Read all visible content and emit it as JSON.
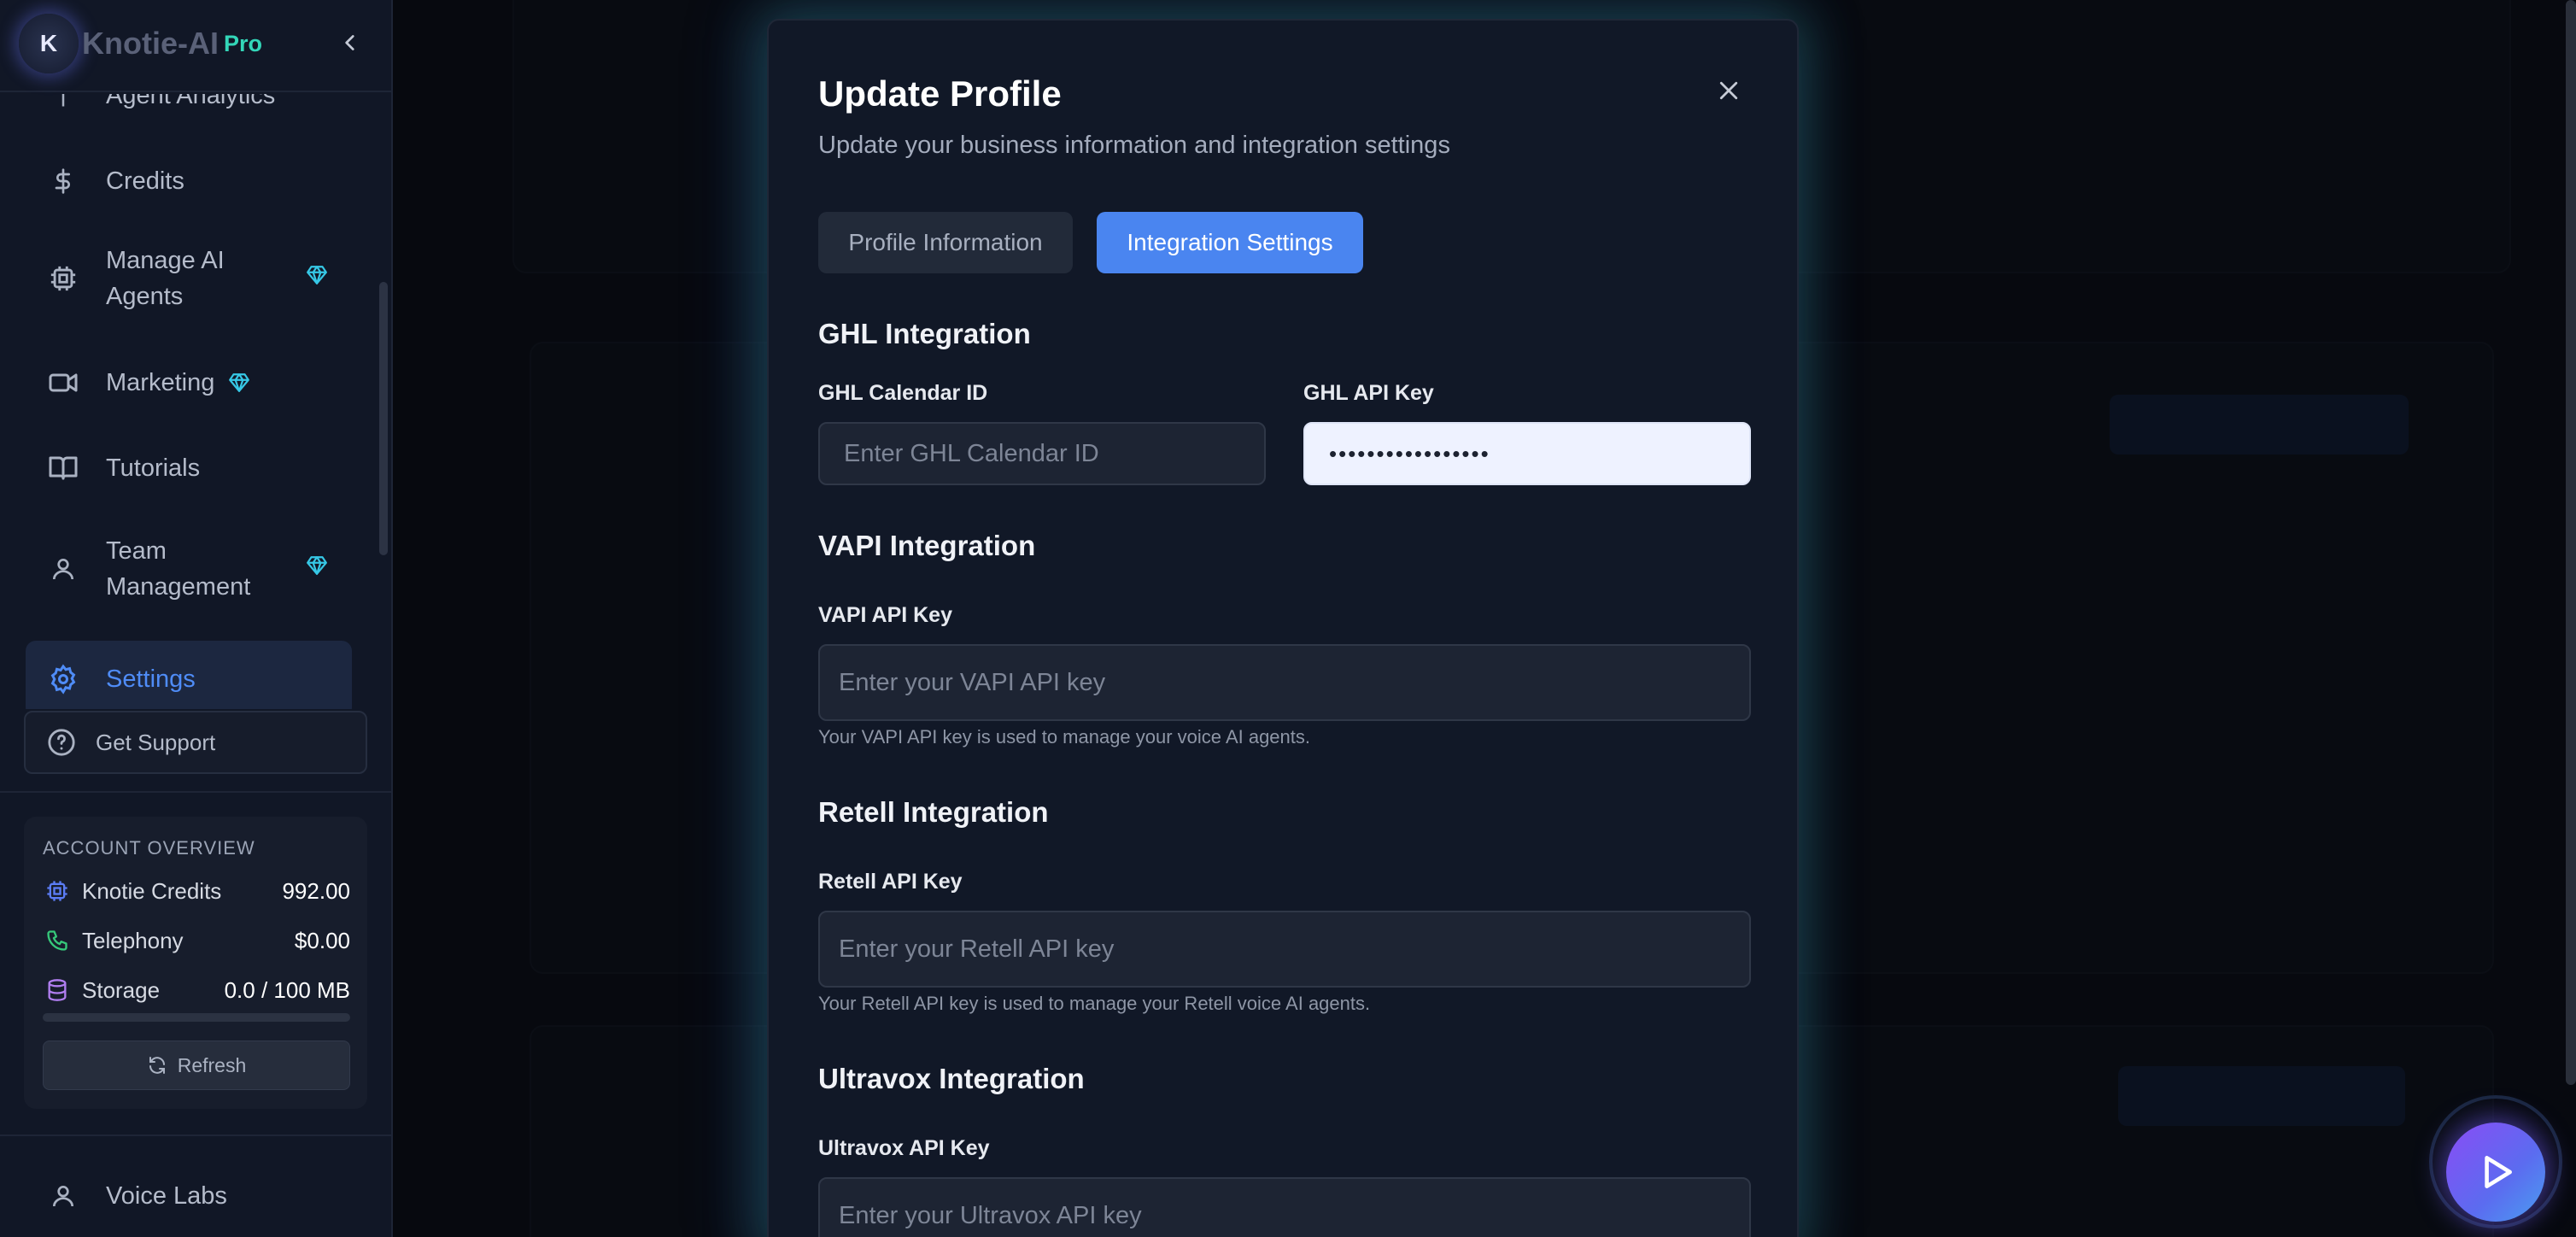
{
  "sidebar": {
    "logo_letter": "K",
    "brand": "Knotie-AI",
    "pro_badge": "Pro",
    "partial_item": "Agent Analytics",
    "items": [
      {
        "label": "Credits",
        "icon": "dollar-icon"
      },
      {
        "label": "Manage AI Agents",
        "icon": "cpu-chip-icon",
        "premium": true
      },
      {
        "label": "Marketing",
        "icon": "video-icon",
        "premium": true
      },
      {
        "label": "Tutorials",
        "icon": "book-icon"
      },
      {
        "label": "Team Management",
        "icon": "user-icon",
        "premium": true
      },
      {
        "label": "Settings",
        "icon": "gear-icon",
        "active": true
      }
    ],
    "support_label": "Get Support",
    "account": {
      "title": "ACCOUNT OVERVIEW",
      "credits_label": "Knotie Credits",
      "credits_value": "992.00",
      "telephony_label": "Telephony",
      "telephony_value": "$0.00",
      "storage_label": "Storage",
      "storage_value": "0.0 / 100 MB",
      "storage_fraction": 0.0,
      "refresh_label": "Refresh"
    },
    "voice_labs_label": "Voice Labs"
  },
  "modal": {
    "title": "Update Profile",
    "subtitle": "Update your business information and integration settings",
    "tabs": [
      "Profile Information",
      "Integration Settings"
    ],
    "active_tab": "Integration Settings",
    "ghl": {
      "heading": "GHL Integration",
      "calendar_label": "GHL Calendar ID",
      "calendar_placeholder": "Enter GHL Calendar ID",
      "api_label": "GHL API Key",
      "api_value": "•••••••••••••••••"
    },
    "vapi": {
      "heading": "VAPI Integration",
      "api_label": "VAPI API Key",
      "api_placeholder": "Enter your VAPI API key",
      "hint": "Your VAPI API key is used to manage your voice AI agents."
    },
    "retell": {
      "heading": "Retell Integration",
      "api_label": "Retell API Key",
      "api_placeholder": "Enter your Retell API key",
      "hint": "Your Retell API key is used to manage your Retell voice AI agents."
    },
    "ultravox": {
      "heading": "Ultravox Integration",
      "api_label": "Ultravox API Key",
      "api_placeholder": "Enter your Ultravox API key"
    }
  },
  "colors": {
    "accent": "#4a85f0",
    "pro": "#33d6b8",
    "background": "#0b0f18",
    "modal_bg": "#111827"
  }
}
